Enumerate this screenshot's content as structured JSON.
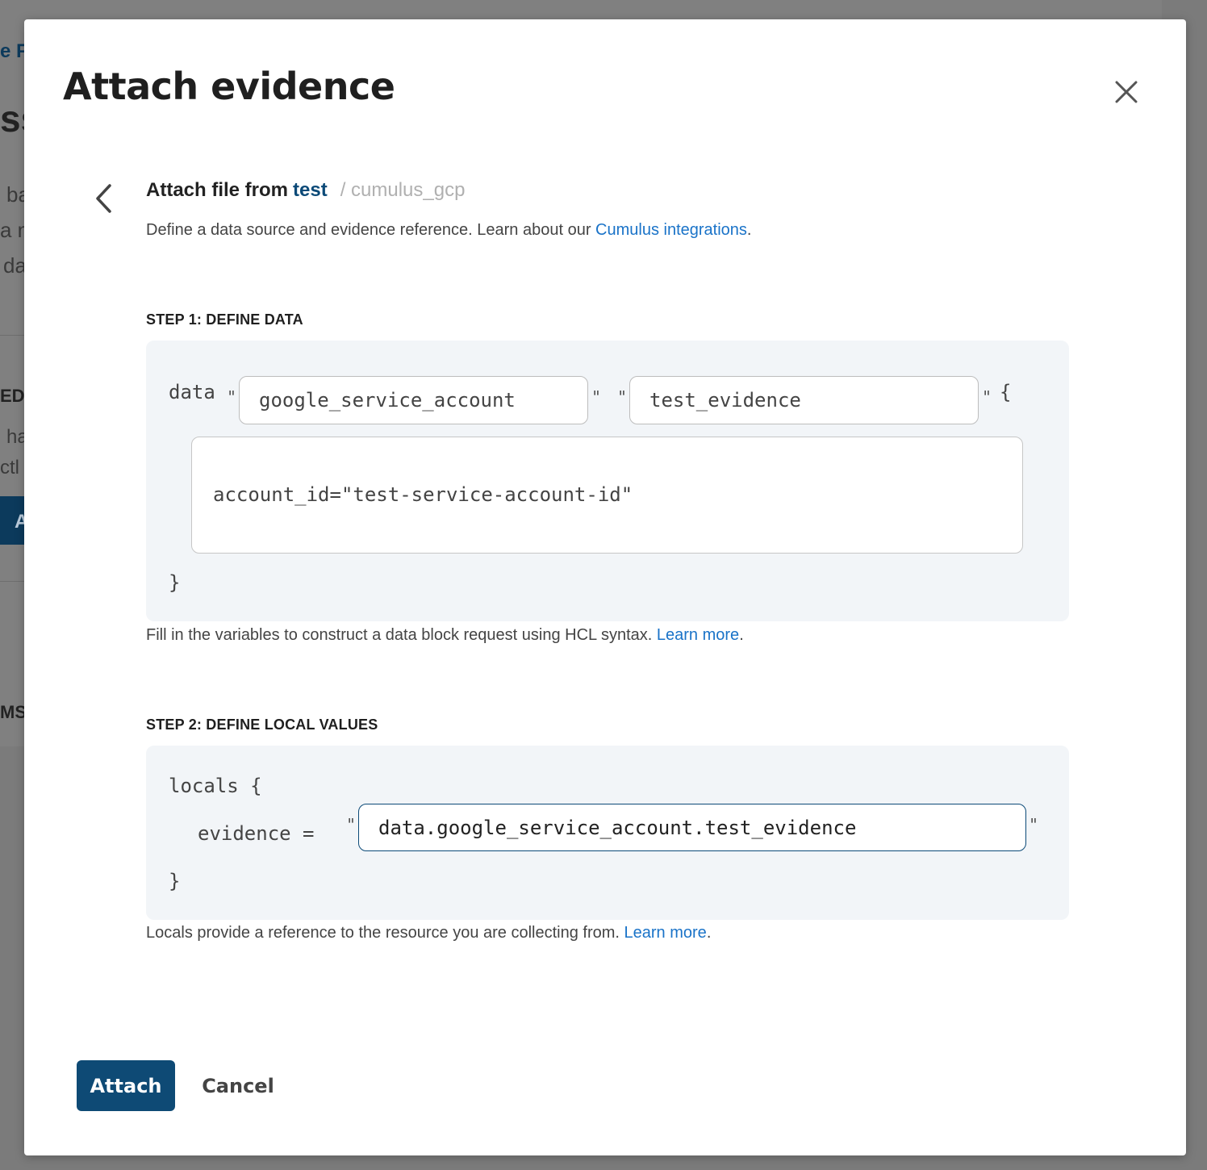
{
  "background": {
    "fragments": [
      "e F",
      "ss",
      "ba",
      "a m",
      "da",
      "EDS",
      "ha",
      "ctl",
      "A",
      "MS"
    ]
  },
  "modal": {
    "title": "Attach evidence",
    "close_icon": "close-icon"
  },
  "source": {
    "back_icon": "chevron-left-icon",
    "lead": "Attach file from",
    "integration_link": "test",
    "separator_path": "/ cumulus_gcp",
    "description_prefix": "Define a data source and evidence reference. Learn about our ",
    "description_link": "Cumulus integrations",
    "description_suffix": "."
  },
  "step1": {
    "label": "STEP 1: DEFINE DATA",
    "keyword": "data",
    "quote": "\"",
    "open_brace": "{",
    "close_brace": "}",
    "type_value": "google_service_account",
    "name_value": "test_evidence",
    "body_value": "account_id=\"test-service-account-id\"",
    "help_prefix": "Fill in the variables to construct a data block request using HCL syntax. ",
    "help_link": "Learn more",
    "help_suffix": "."
  },
  "step2": {
    "label": "STEP 2: DEFINE LOCAL VALUES",
    "keyword": "locals {",
    "key": "evidence =",
    "quote": "\"",
    "close_brace": "}",
    "value": "data.google_service_account.test_evidence",
    "help_prefix": "Locals provide a reference to the resource you are collecting from. ",
    "help_link": "Learn more",
    "help_suffix": "."
  },
  "actions": {
    "attach_label": "Attach",
    "cancel_label": "Cancel"
  },
  "colors": {
    "primary": "#0e4a75",
    "link": "#1a73c8",
    "code_bg": "#f2f5f8",
    "overlay": "#7b7b7b"
  }
}
